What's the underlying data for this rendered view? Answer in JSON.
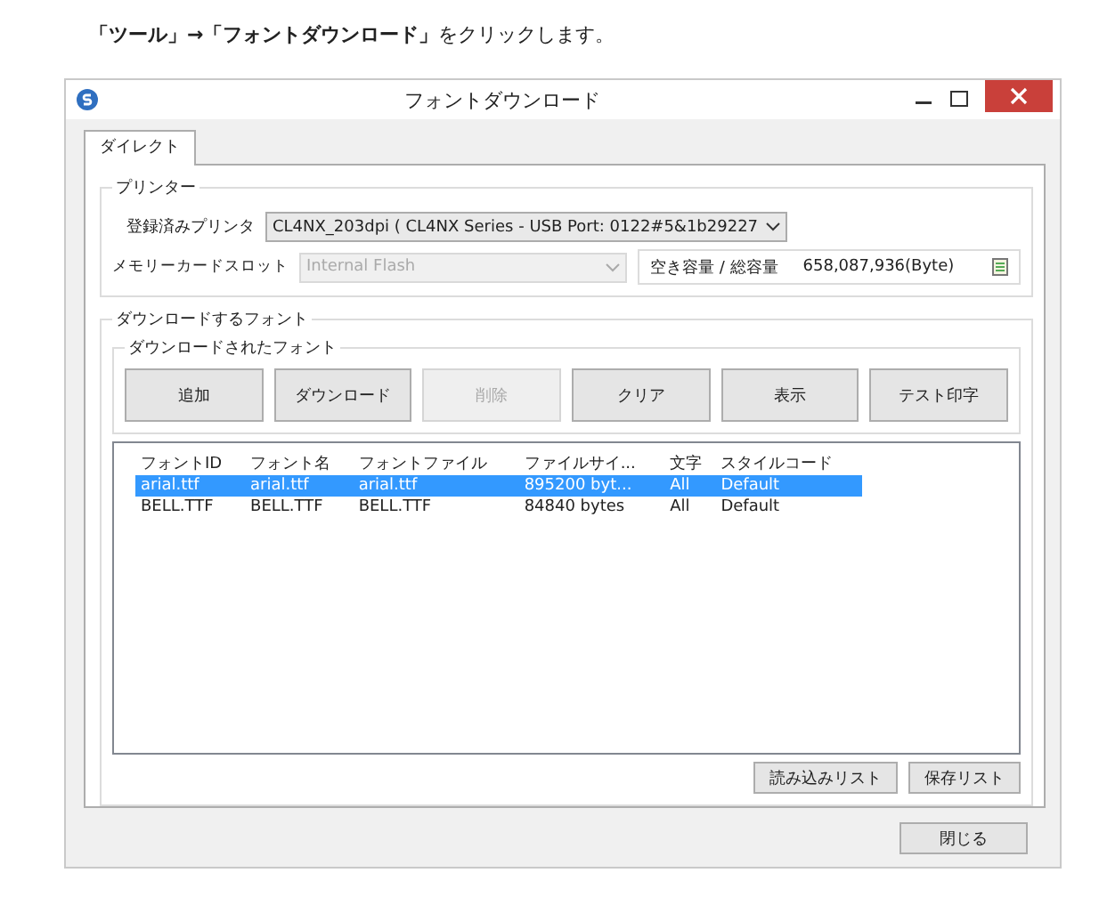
{
  "instruction": "**「ツール」→「フォントダウンロード」**をクリックします。",
  "window": {
    "title": "フォントダウンロード"
  },
  "tabs": [
    {
      "label": "ダイレクト",
      "selected": true
    }
  ],
  "printer": {
    "title": "プリンター",
    "registered_label": "登録済みプリンタ",
    "registered_value": "CL4NX_203dpi ( CL4NX Series - USB Port: 0122#5&1b29227",
    "memory_label": "メモリーカードスロット",
    "memory_value": "Internal Flash",
    "memory_disabled": true,
    "capacity_label": "空き容量 / 総容量",
    "capacity_value": "658,087,936(Byte)"
  },
  "download": {
    "title": "ダウンロードするフォント",
    "subtitle": "ダウンロードされたフォント",
    "buttons": [
      {
        "label": "追加",
        "disabled": false
      },
      {
        "label": "ダウンロード",
        "disabled": false
      },
      {
        "label": "削除",
        "disabled": true
      },
      {
        "label": "クリア",
        "disabled": false
      },
      {
        "label": "表示",
        "disabled": false
      },
      {
        "label": "テスト印字",
        "disabled": false
      }
    ],
    "table": {
      "columns": [
        "フォントID",
        "フォント名",
        "フォントファイル",
        "ファイルサイ...",
        "文字",
        "スタイルコード"
      ],
      "rows": [
        {
          "cells": [
            "arial.ttf",
            "arial.ttf",
            "arial.ttf",
            "895200 byt...",
            "All",
            "Default"
          ],
          "selected": true
        },
        {
          "cells": [
            "BELL.TTF",
            "BELL.TTF",
            "BELL.TTF",
            "84840 bytes",
            "All",
            "Default"
          ],
          "selected": false
        }
      ]
    },
    "list_buttons": [
      "読み込みリスト",
      "保存リスト"
    ]
  },
  "close_button": "閉じる"
}
